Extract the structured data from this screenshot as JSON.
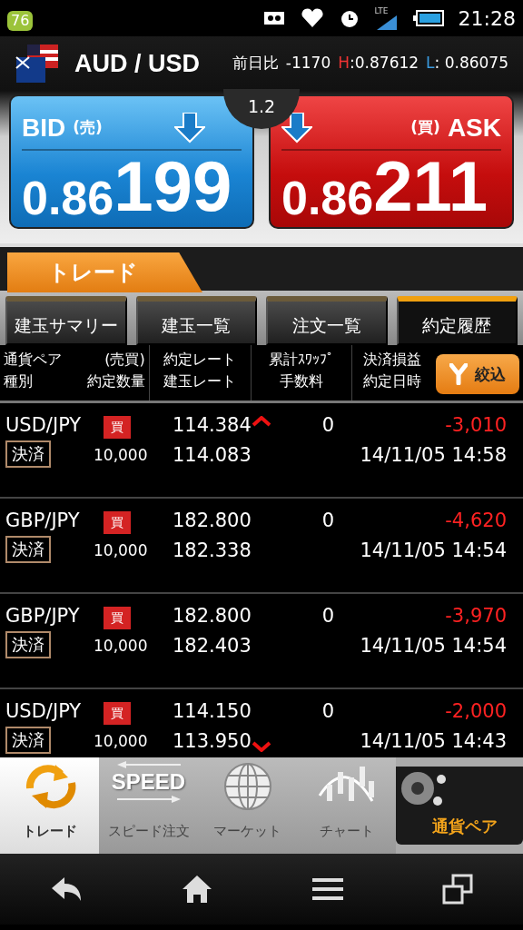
{
  "status_bar": {
    "badge": "76",
    "network": "LTE",
    "time": "21:28"
  },
  "header": {
    "pair": "AUD / USD",
    "change_label": "前日比",
    "change": "-1170",
    "high_label": "H",
    "high": ":0.87612",
    "low_label": "L",
    "low": ": 0.86075"
  },
  "quotes": {
    "spread": "1.2",
    "bid": {
      "label": "BID",
      "side": "(売)",
      "price_main": "0.86",
      "price_pips": "199"
    },
    "ask": {
      "label": "ASK",
      "side": "(買)",
      "price_main": "0.86",
      "price_pips": "211"
    }
  },
  "main_tab": "トレード",
  "tabs": [
    {
      "label": "建玉サマリー",
      "selected": false
    },
    {
      "label": "建玉一覧",
      "selected": false
    },
    {
      "label": "注文一覧",
      "selected": false
    },
    {
      "label": "約定履歴",
      "selected": true
    }
  ],
  "columns": [
    {
      "top": "通貨ペア",
      "bottom": "種別"
    },
    {
      "top": "(売買)",
      "bottom": "約定数量"
    },
    {
      "top": "約定レート",
      "bottom": "建玉レート"
    },
    {
      "top": "累計ｽﾜｯﾌﾟ",
      "bottom": "手数料"
    },
    {
      "top": "決済損益",
      "bottom": "約定日時"
    }
  ],
  "filter_button": "絞込",
  "rows": [
    {
      "pair": "USD/JPY",
      "side": "買",
      "type": "決済",
      "quantity": "10,000",
      "rate": "114.384",
      "position_rate": "114.083",
      "swap": "0",
      "profit": "-3,010",
      "datetime": "14/11/05 14:58"
    },
    {
      "pair": "GBP/JPY",
      "side": "買",
      "type": "決済",
      "quantity": "10,000",
      "rate": "182.800",
      "position_rate": "182.338",
      "swap": "0",
      "profit": "-4,620",
      "datetime": "14/11/05 14:54"
    },
    {
      "pair": "GBP/JPY",
      "side": "買",
      "type": "決済",
      "quantity": "10,000",
      "rate": "182.800",
      "position_rate": "182.403",
      "swap": "0",
      "profit": "-3,970",
      "datetime": "14/11/05 14:54"
    },
    {
      "pair": "USD/JPY",
      "side": "買",
      "type": "決済",
      "quantity": "10,000",
      "rate": "114.150",
      "position_rate": "113.950",
      "swap": "0",
      "profit": "-2,000",
      "datetime": "14/11/05 14:43"
    }
  ],
  "bottom_nav": [
    {
      "kind": "trade",
      "label": "トレード",
      "selected": true
    },
    {
      "kind": "speed",
      "icon_text": "SPEED",
      "label": "スピード注文",
      "selected": false
    },
    {
      "kind": "market",
      "label": "マーケット",
      "selected": false
    },
    {
      "kind": "chart",
      "label": "チャート",
      "selected": false
    }
  ],
  "currency_button": "通貨ペア"
}
